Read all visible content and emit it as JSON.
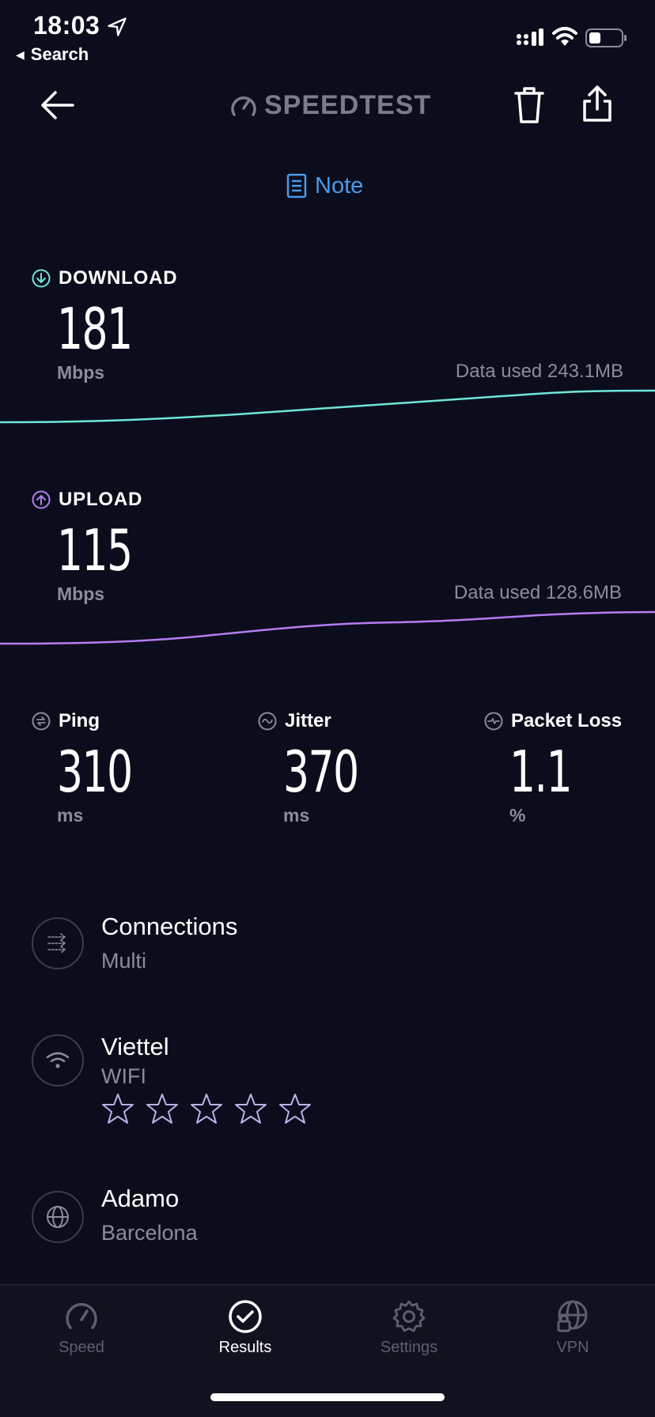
{
  "status_bar": {
    "time": "18:03",
    "back_label": "Search"
  },
  "header": {
    "brand": "SPEEDTEST",
    "icons": [
      "back-arrow-icon",
      "speedometer-icon",
      "trash-icon",
      "share-icon"
    ]
  },
  "note": {
    "label": "Note"
  },
  "download": {
    "label": "DOWNLOAD",
    "value": "181",
    "unit": "Mbps",
    "data_used": "Data used 243.1MB",
    "color": "#6ee7d8"
  },
  "upload": {
    "label": "UPLOAD",
    "value": "115",
    "unit": "Mbps",
    "data_used": "Data used 128.6MB",
    "color": "#b57cf2"
  },
  "stats": {
    "ping": {
      "label": "Ping",
      "value": "310",
      "unit": "ms"
    },
    "jitter": {
      "label": "Jitter",
      "value": "370",
      "unit": "ms"
    },
    "packet_loss": {
      "label": "Packet Loss",
      "value": "1.1",
      "unit": "%"
    }
  },
  "info": {
    "connections": {
      "title": "Connections",
      "subtitle": "Multi"
    },
    "provider": {
      "title": "Viettel",
      "subtitle": "WIFI",
      "rating": 0,
      "rating_max": 5
    },
    "server": {
      "title": "Adamo",
      "subtitle": "Barcelona"
    }
  },
  "tabs": [
    {
      "label": "Speed",
      "icon": "speedometer-icon",
      "active": false
    },
    {
      "label": "Results",
      "icon": "check-circle-icon",
      "active": true
    },
    {
      "label": "Settings",
      "icon": "gear-icon",
      "active": false
    },
    {
      "label": "VPN",
      "icon": "globe-lock-icon",
      "active": false
    }
  ],
  "colors": {
    "background": "#0c0d1c",
    "accent_blue": "#4a9be9",
    "download": "#6ee7d8",
    "upload": "#b57cf2",
    "muted": "#8a8c9e"
  }
}
